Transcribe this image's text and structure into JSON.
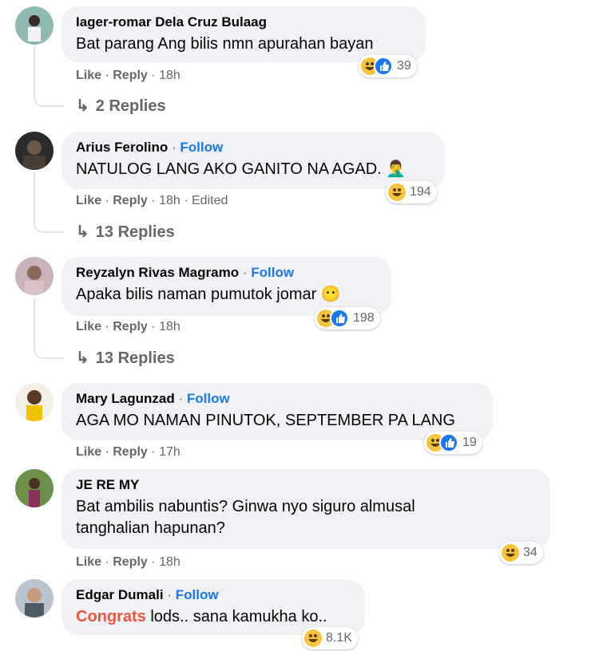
{
  "comments": [
    {
      "name": "Iager-romar Dela Cruz Bulaag",
      "follow": "",
      "text": "Bat parang Ang bilis nmn apurahan bayan",
      "like": "Like",
      "reply": "Reply",
      "time": "18h",
      "edited": "",
      "reaction_count": "39",
      "replies": "2 Replies"
    },
    {
      "name": "Arius Ferolino",
      "follow": "Follow",
      "text": "NATULOG LANG AKO GANITO NA AGAD. 🤦‍♂️",
      "like": "Like",
      "reply": "Reply",
      "time": "18h",
      "edited": "Edited",
      "reaction_count": "194",
      "replies": "13 Replies"
    },
    {
      "name": "Reyzalyn Rivas Magramo",
      "follow": "Follow",
      "text": "Apaka bilis naman pumutok jomar 😶",
      "like": "Like",
      "reply": "Reply",
      "time": "18h",
      "edited": "",
      "reaction_count": "198",
      "replies": "13 Replies"
    },
    {
      "name": "Mary Lagunzad",
      "follow": "Follow",
      "text": "AGA MO NAMAN PINUTOK, SEPTEMBER PA LANG",
      "like": "Like",
      "reply": "Reply",
      "time": "17h",
      "edited": "",
      "reaction_count": "19",
      "replies": ""
    },
    {
      "name": "JE RE MY",
      "follow": "",
      "text_line1": "Bat ambilis nabuntis? Ginwa nyo siguro almusal",
      "text_line2": "tanghalian hapunan?",
      "like": "Like",
      "reply": "Reply",
      "time": "18h",
      "edited": "",
      "reaction_count": "34",
      "replies": ""
    },
    {
      "name": "Edgar Dumali",
      "follow": "Follow",
      "text_highlight": "Congrats",
      "text_rest": " lods.. sana kamukha ko..",
      "reaction_count": "8.1K"
    }
  ],
  "separator": "·",
  "colors": {
    "follow": "#1877f2",
    "highlight": "#f0553b",
    "bubble": "#f0f2f5"
  }
}
